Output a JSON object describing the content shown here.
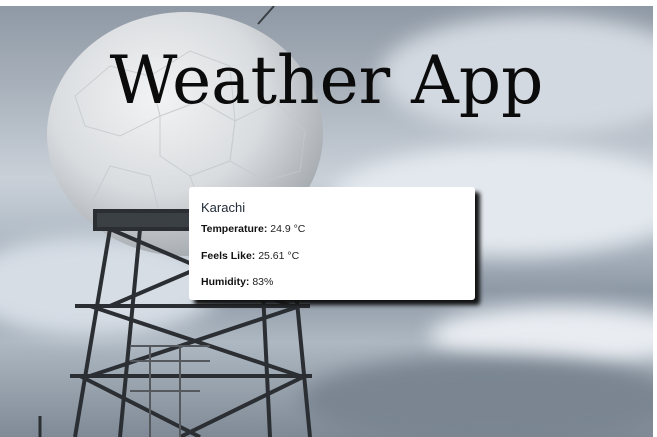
{
  "app": {
    "title": "Weather App"
  },
  "weather": {
    "city": "Karachi",
    "temperature_label": "Temperature:",
    "temperature_value": "24.9 °C",
    "feels_like_label": "Feels Like:",
    "feels_like_value": "25.61 °C",
    "humidity_label": "Humidity:",
    "humidity_value": "83%"
  },
  "colors": {
    "card_background": "#ffffff",
    "title_text": "#0b0b0b"
  }
}
